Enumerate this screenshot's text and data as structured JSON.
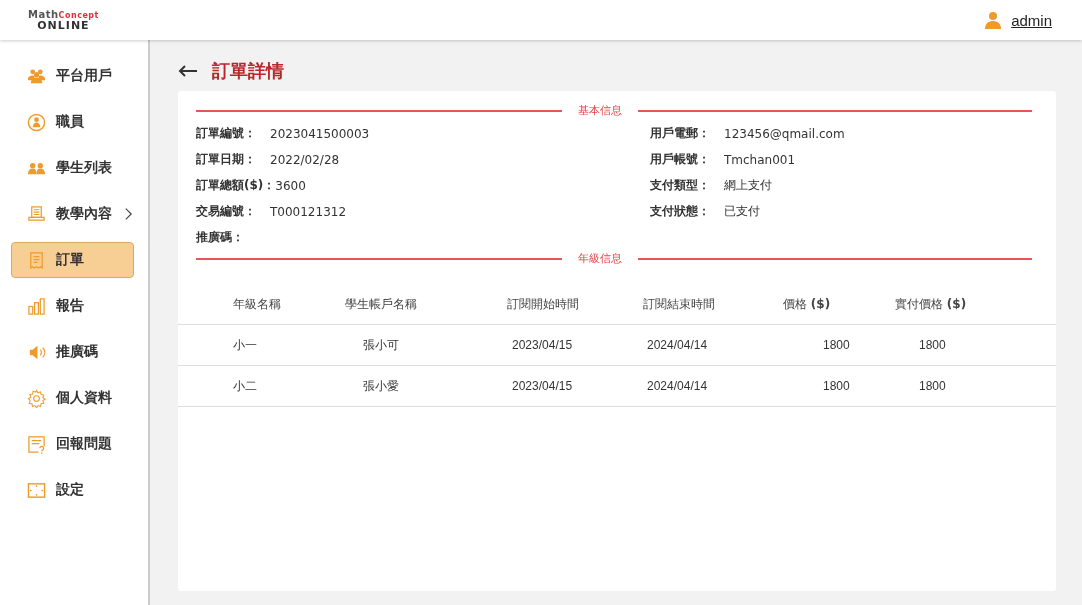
{
  "header": {
    "logo": {
      "top_left": "Math",
      "top_right": "Concept",
      "bottom": "ONLINE"
    },
    "user": "admin"
  },
  "sidebar": {
    "items": [
      {
        "label": "平台用戶",
        "selected": false,
        "expandable": false
      },
      {
        "label": "職員",
        "selected": false,
        "expandable": false
      },
      {
        "label": "學生列表",
        "selected": false,
        "expandable": false
      },
      {
        "label": "教學內容",
        "selected": false,
        "expandable": true
      },
      {
        "label": "訂單",
        "selected": true,
        "expandable": false
      },
      {
        "label": "報告",
        "selected": false,
        "expandable": false
      },
      {
        "label": "推廣碼",
        "selected": false,
        "expandable": false
      },
      {
        "label": "個人資料",
        "selected": false,
        "expandable": false
      },
      {
        "label": "回報問題",
        "selected": false,
        "expandable": false
      },
      {
        "label": "設定",
        "selected": false,
        "expandable": false
      }
    ]
  },
  "page": {
    "title": "訂單詳情"
  },
  "basic_info": {
    "heading": "基本信息",
    "left": [
      {
        "label": "訂單編號：",
        "value": "2023041500003"
      },
      {
        "label": "訂單日期：",
        "value": "2022/02/28"
      },
      {
        "label": "訂單總額($)：",
        "value": "3600"
      },
      {
        "label": "交易編號：",
        "value": "T000121312"
      },
      {
        "label": "推廣碼："
      }
    ],
    "right": [
      {
        "label": "用戶電郵：",
        "value": "123456@qmail.com"
      },
      {
        "label": "用戶帳號：",
        "value": "Tmchan001"
      },
      {
        "label": "支付類型：",
        "value": "網上支付"
      },
      {
        "label": "支付狀態：",
        "value": "已支付"
      }
    ]
  },
  "grade_info": {
    "heading": "年級信息",
    "table": {
      "columns": [
        "年級名稱",
        "學生帳戶名稱",
        "訂閱開始時間",
        "訂閱結束時間",
        "價格 **($)**",
        "實付價格 **($)**"
      ],
      "rows": [
        [
          "小一",
          "張小可",
          "2023/04/15",
          "2024/04/14",
          "1800",
          "1800"
        ],
        [
          "小二",
          "張小愛",
          "2023/04/15",
          "2024/04/14",
          "1800",
          "1800"
        ]
      ]
    }
  }
}
